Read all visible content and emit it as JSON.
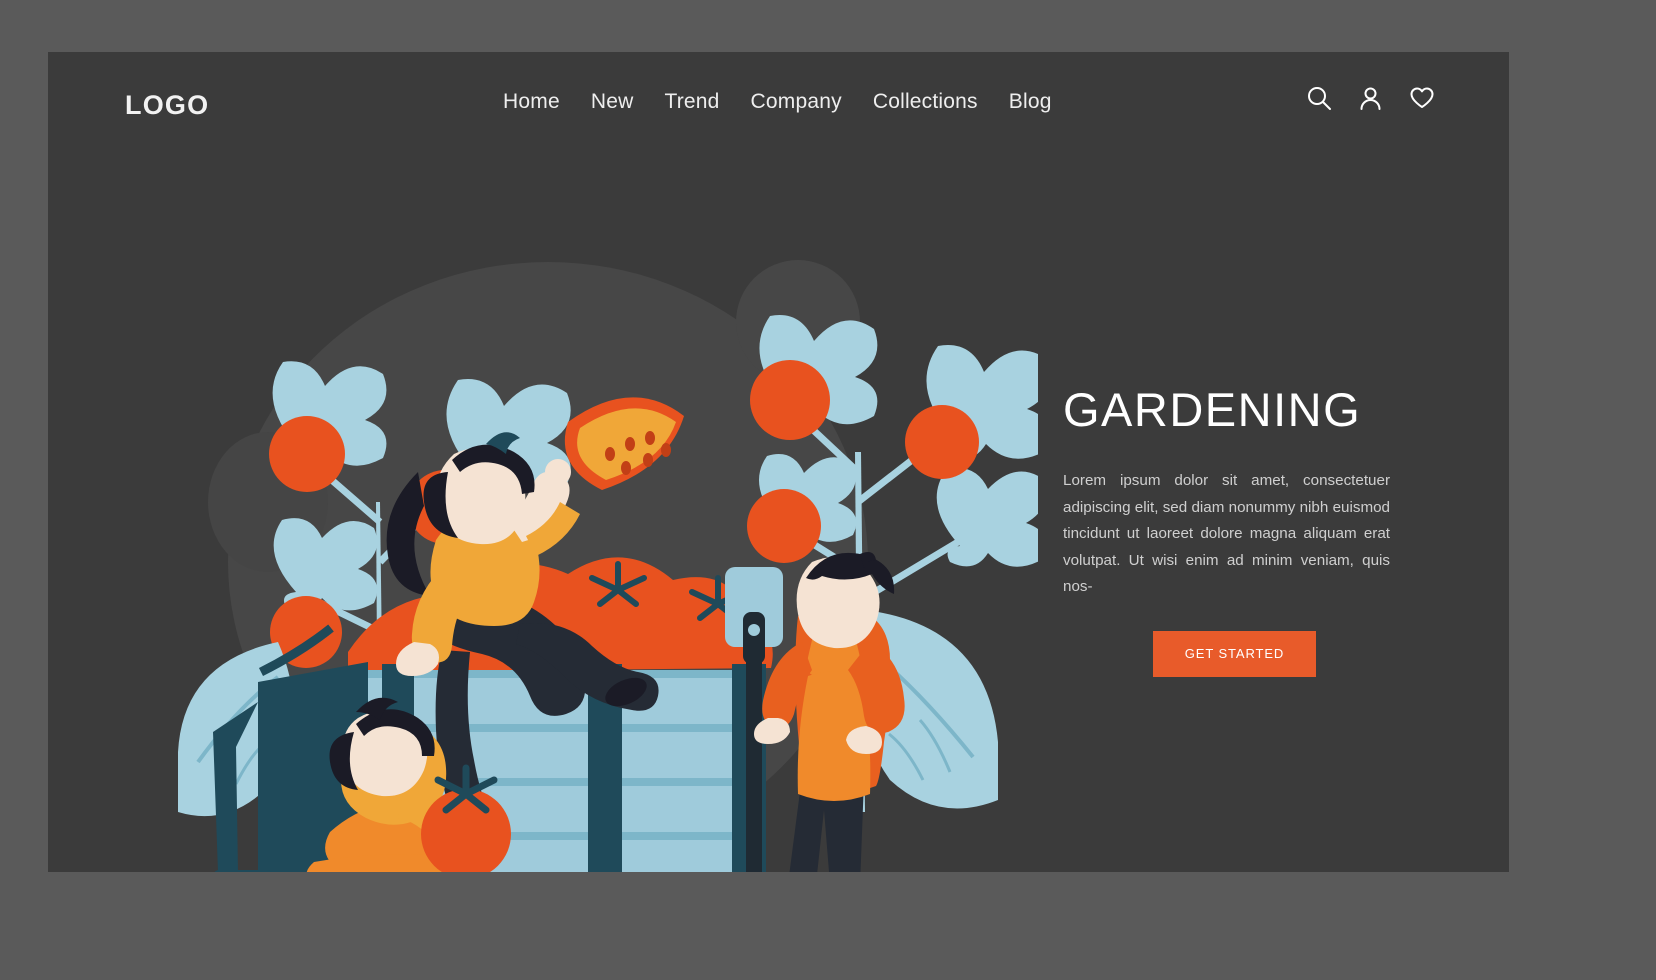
{
  "site": {
    "logo": "LOGO"
  },
  "nav": {
    "items": [
      {
        "label": "Home"
      },
      {
        "label": "New"
      },
      {
        "label": "Trend"
      },
      {
        "label": "Company"
      },
      {
        "label": "Collections"
      },
      {
        "label": "Blog"
      }
    ],
    "icons": [
      {
        "name": "search-icon"
      },
      {
        "name": "user-icon"
      },
      {
        "name": "heart-icon"
      }
    ]
  },
  "hero": {
    "title": "GARDENING",
    "paragraph": "Lorem ipsum dolor sit amet, consectetuer adipiscing elit, sed diam nonummy nibh euismod tincidunt ut laoreet dolore magna aliquam erat volutpat. Ut wisi enim ad minim veniam, quis nos-",
    "cta_label": "GET STARTED"
  },
  "colors": {
    "page_background": "#5a5a5a",
    "card_background": "#3b3b3b",
    "accent": "#e85b2a",
    "tomato": "#e8521f",
    "leaf_blue": "#a8d2e0",
    "dark_teal": "#1f4a5a",
    "crate_light": "#9fcbdb",
    "crate_mid": "#7db6c9",
    "text_light": "#ffffff",
    "text_muted": "#cfcfcf",
    "skin": "#f5e3d3",
    "hair": "#1b1b26",
    "shirt_yellow": "#f0a738",
    "apron_orange": "#f08a2b"
  },
  "illustration": {
    "name": "gardening-people-tomato-crate",
    "elements": [
      "blob-background",
      "tomato-plant-left",
      "tomato-plant-right",
      "leaf-left",
      "leaf-right",
      "crate",
      "woman-sitting-on-crate-with-tomato-slice",
      "woman-kneeling-with-tomato",
      "man-standing-with-shovel",
      "watering-can",
      "ground-line"
    ]
  }
}
